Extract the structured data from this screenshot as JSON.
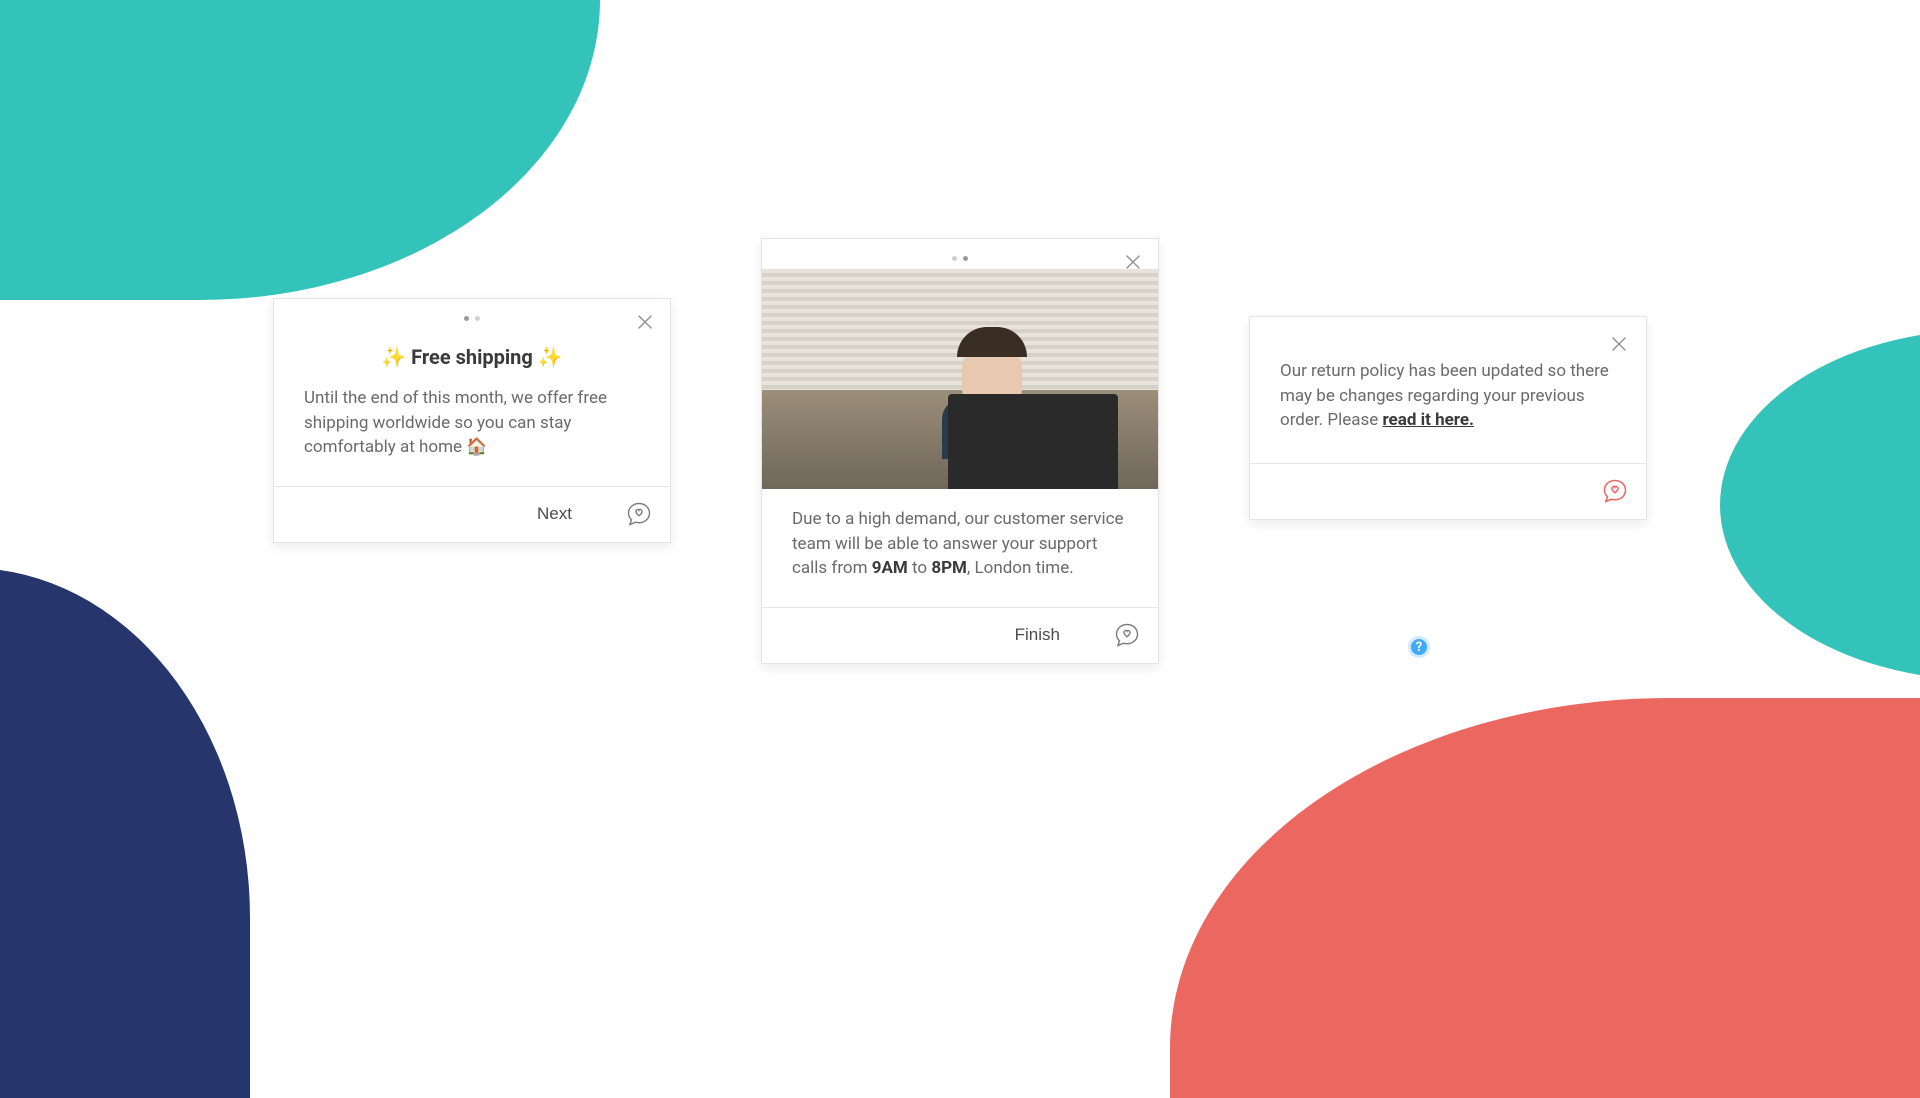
{
  "card1": {
    "title_prefix": "✨ ",
    "title": "Free shipping",
    "title_suffix": " ✨",
    "body": "Until the end of this month, we offer free shipping worldwide so you can stay comfortably at home 🏠",
    "next_label": "Next"
  },
  "card2": {
    "body_pre": "Due to a high demand, our customer service team will be able to answer your support calls from ",
    "time1": "9AM",
    "mid": " to ",
    "time2": "8PM",
    "body_post": ", London time.",
    "finish_label": "Finish"
  },
  "card3": {
    "body_pre": "Our return policy has been updated so there may be changes regarding your previous order. Please ",
    "link_text": "read it here."
  },
  "help": {
    "label": "?"
  }
}
